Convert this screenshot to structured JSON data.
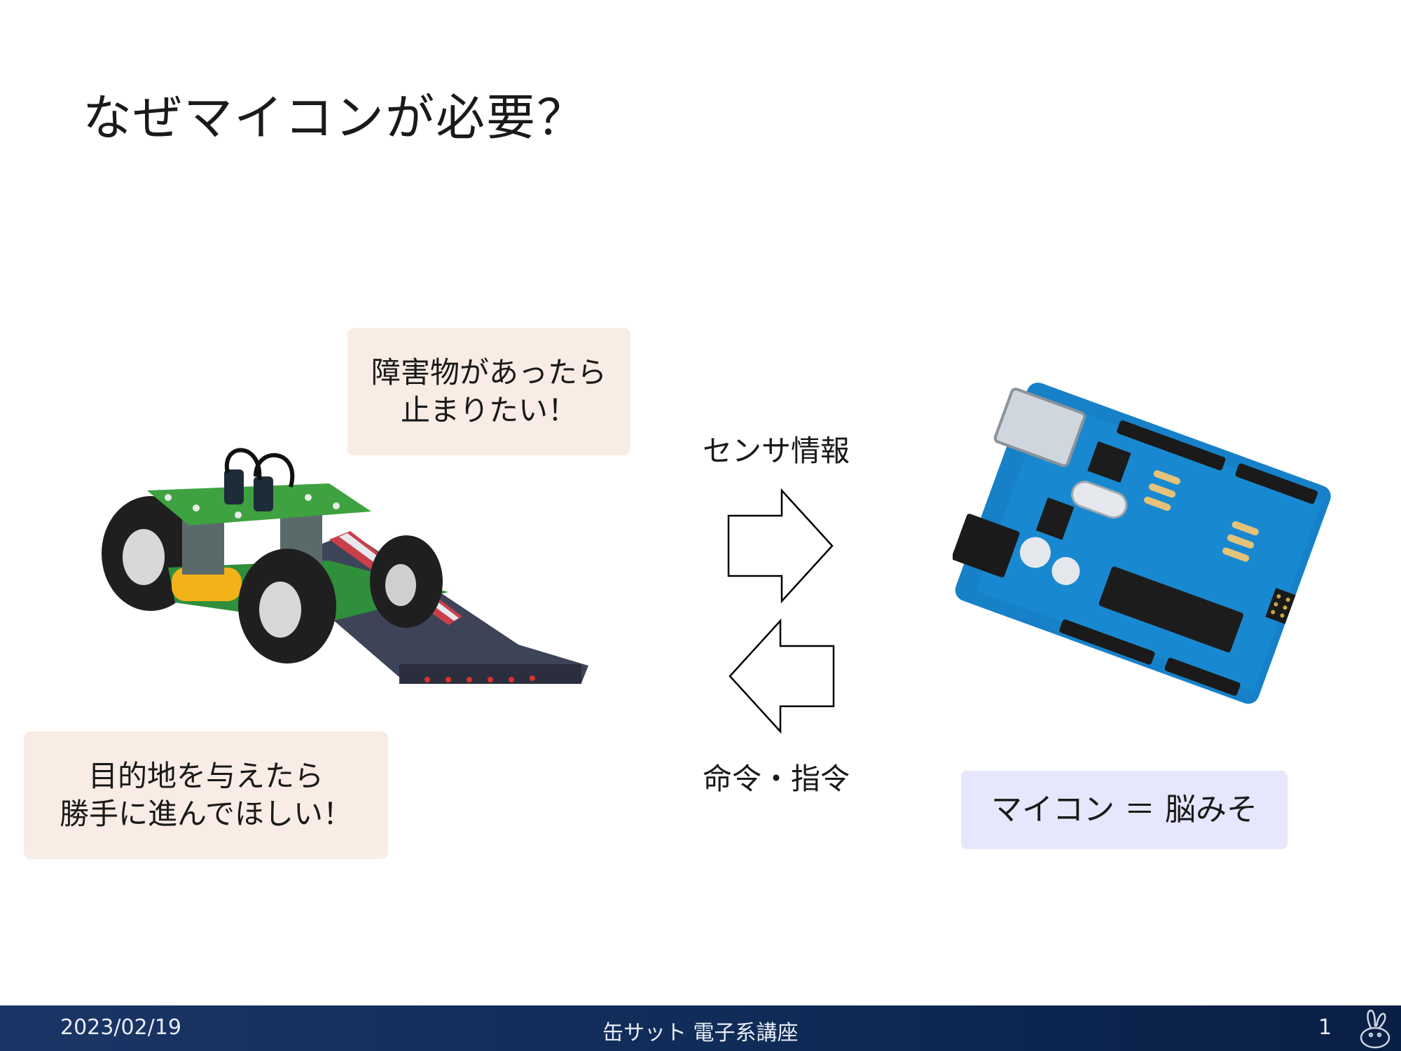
{
  "slide": {
    "title": "なぜマイコンが必要？",
    "bubble_stop": [
      "障害物があったら",
      "止まりたい！"
    ],
    "bubble_destination": [
      "目的地を与えたら",
      "勝手に進んでほしい！"
    ],
    "arrow_top_label": "センサ情報",
    "arrow_bottom_label": "命令・指令",
    "mcu_label": "マイコン ＝ 脳みそ"
  },
  "footer": {
    "date": "2023/02/19",
    "center": "缶サット 電子系講座",
    "page": "1"
  },
  "colors": {
    "bubble_bg": "#f8ece4",
    "mcu_bg": "#e6e6fc",
    "footer_bg": "#0e2a55"
  }
}
